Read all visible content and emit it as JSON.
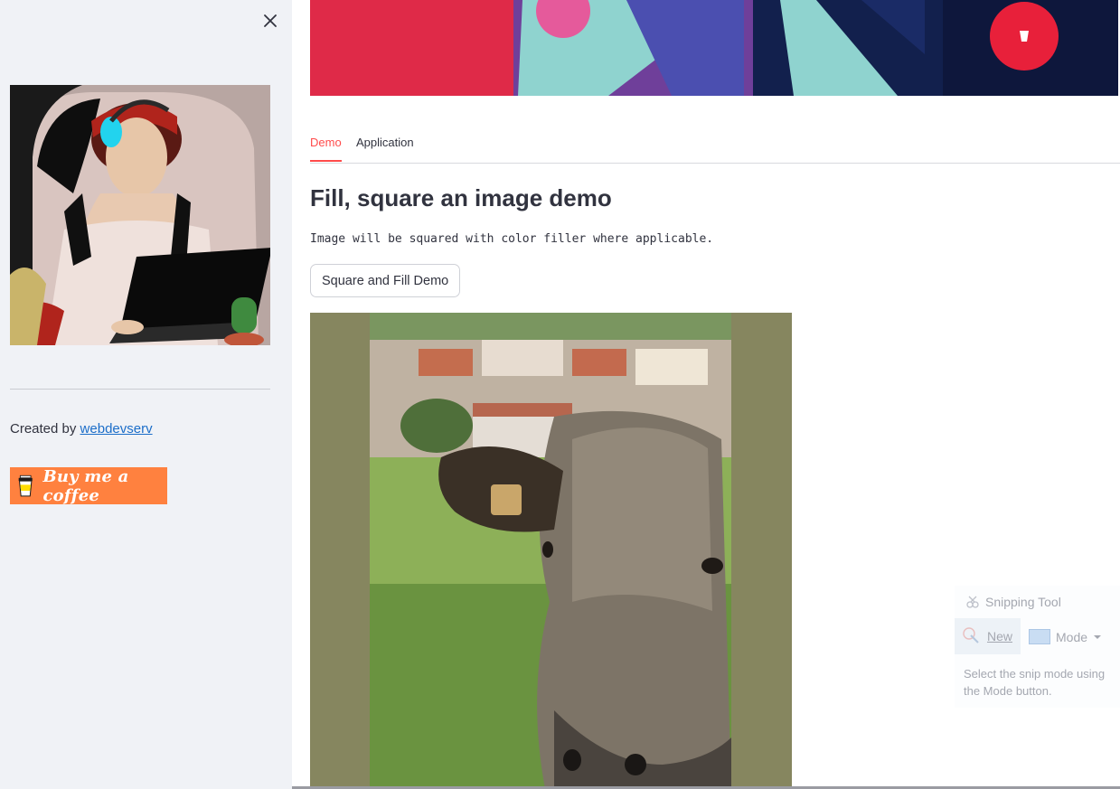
{
  "sidebar": {
    "close_icon": "close-icon",
    "created_by_prefix": "Created by ",
    "created_by_link": "webdevserv",
    "bmc_label": "Buy me a coffee"
  },
  "tabs": [
    {
      "label": "Demo",
      "active": true
    },
    {
      "label": "Application",
      "active": false
    }
  ],
  "main": {
    "title": "Fill, square an image demo",
    "code_text": "Image will be squared with color filler where applicable.",
    "demo_button": "Square and Fill Demo",
    "filler_color": "#86865f"
  },
  "snipping_tool": {
    "title": "Snipping Tool",
    "new_label": "New",
    "mode_label": "Mode",
    "help_text": "Select the snip mode using the Mode button."
  },
  "colors": {
    "accent": "#ff4b4b",
    "link": "#1c6ec9",
    "sidebar_bg": "#f0f2f6",
    "bmc_orange": "#ff813f"
  }
}
